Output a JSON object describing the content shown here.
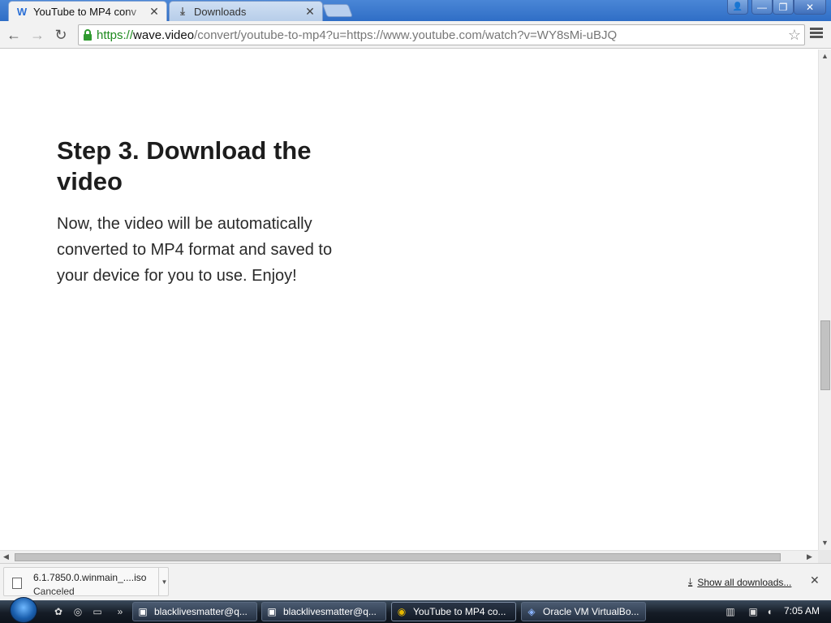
{
  "tabs": [
    {
      "title": "YouTube to MP4 conv",
      "favicon": "W",
      "close": "✕"
    },
    {
      "title": "Downloads",
      "favicon": "⤓",
      "close": "✕"
    }
  ],
  "window_controls": {
    "user": "👤",
    "minimize": "—",
    "restore": "❐",
    "close": "✕"
  },
  "toolbar": {
    "back": "←",
    "forward": "→",
    "reload": "↻",
    "url_scheme": "https://",
    "url_host": "wave.video",
    "url_path": "/convert/youtube-to-mp4?u=https://www.youtube.com/watch?v=WY8sMi-uBJQ",
    "star": "☆"
  },
  "content": {
    "heading": "Step 3. Download the video",
    "body": "Now, the video will be automatically converted to MP4 format and saved to your device for you to use. Enjoy!"
  },
  "scrollbars": {
    "up": "▲",
    "down": "▼",
    "left": "◀",
    "right": "▶"
  },
  "download_shelf": {
    "filename": "6.1.7850.0.winmain_....iso",
    "status": "Canceled",
    "dropdown": "▼",
    "show_all_icon": "⤓",
    "show_all": "Show all downloads...",
    "close": "✕"
  },
  "taskbar": {
    "quicklaunch_more": "»",
    "tasks": [
      {
        "label": "blacklivesmatter@q...",
        "icon": "▣"
      },
      {
        "label": "blacklivesmatter@q...",
        "icon": "▣"
      },
      {
        "label": "YouTube to MP4 co...",
        "icon": "◉"
      },
      {
        "label": "Oracle VM VirtualBo...",
        "icon": "◈"
      }
    ],
    "clock": "7:05 AM"
  },
  "colors": {
    "tabstrip": "#2f6ec6",
    "secure_scheme": "#1e8a1e",
    "taskbar": "#151c26"
  }
}
